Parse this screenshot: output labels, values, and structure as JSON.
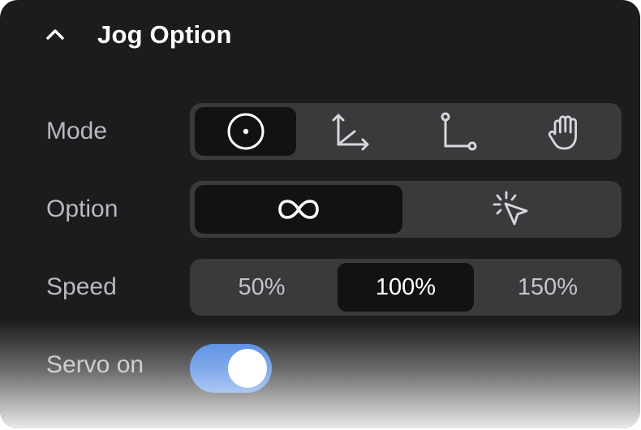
{
  "header": {
    "title": "Jog Option",
    "collapse_icon": "chevron-up-icon"
  },
  "mode": {
    "label": "Mode",
    "options": [
      {
        "icon": "target-circle-icon",
        "selected": true
      },
      {
        "icon": "axes-arrows-icon",
        "selected": false
      },
      {
        "icon": "joint-link-icon",
        "selected": false
      },
      {
        "icon": "hand-icon",
        "selected": false
      }
    ]
  },
  "option": {
    "label": "Option",
    "options": [
      {
        "icon": "infinity-icon",
        "selected": true
      },
      {
        "icon": "cursor-click-icon",
        "selected": false
      }
    ]
  },
  "speed": {
    "label": "Speed",
    "options": [
      {
        "label": "50%",
        "selected": false
      },
      {
        "label": "100%",
        "selected": true
      },
      {
        "label": "150%",
        "selected": false
      }
    ]
  },
  "servo": {
    "label": "Servo on",
    "on": true,
    "accent_color": "#3f7ee0"
  }
}
